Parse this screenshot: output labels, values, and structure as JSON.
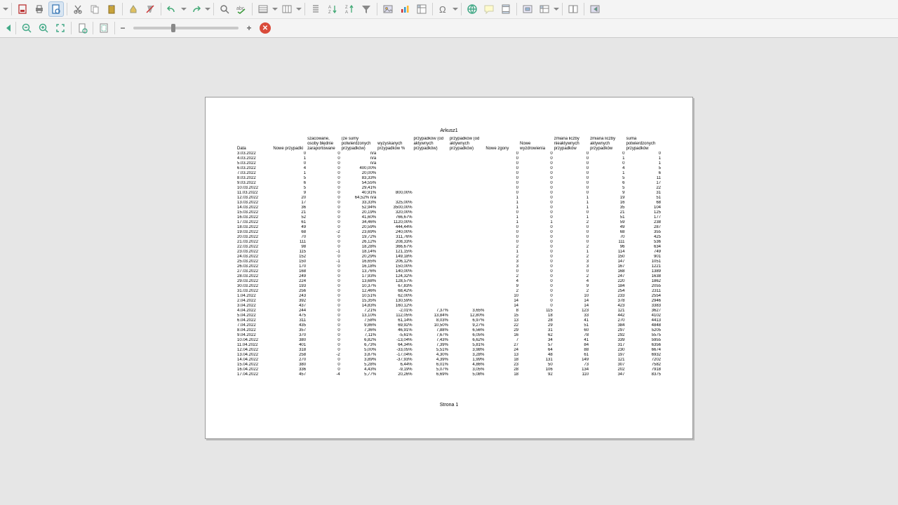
{
  "sheet": {
    "title": "Arkusz1",
    "footer": "Strona 1"
  },
  "zoom": {
    "minus": "−",
    "plus": "+",
    "thumb_pct": 36
  },
  "headers": [
    "Data",
    "Nowe przypadki",
    "szacowane, osoby błędnie zaraportowane",
    "(ze sumy potwierdzonych przypadków)",
    "wyzyskanych przypadków %",
    "przypadków (od aktywnych przypadków)",
    "przypadków (od aktywnych przypadków)",
    "Nowe zgony",
    "Nowe wyzdrowienia",
    "zmiana liczby nieaktywnych przypadków",
    "zmiana liczby aktywnych przypadków",
    "suma potwierdzonych przypadków"
  ],
  "rows": [
    [
      "3.03.2022",
      "0",
      "0",
      "n/a",
      "",
      "",
      "",
      "0",
      "0",
      "0",
      "0",
      "0"
    ],
    [
      "4.03.2022",
      "1",
      "0",
      "n/a",
      "",
      "",
      "",
      "0",
      "0",
      "0",
      "1",
      "1"
    ],
    [
      "5.03.2022",
      "0",
      "0",
      "n/a",
      "",
      "",
      "",
      "0",
      "0",
      "0",
      "0",
      "1"
    ],
    [
      "6.03.2022",
      "4",
      "0",
      "400,00%",
      "",
      "",
      "",
      "0",
      "0",
      "0",
      "4",
      "5"
    ],
    [
      "7.03.2022",
      "1",
      "0",
      "20,00%",
      "",
      "",
      "",
      "0",
      "0",
      "0",
      "1",
      "6"
    ],
    [
      "8.03.2022",
      "5",
      "0",
      "83,33%",
      "",
      "",
      "",
      "0",
      "0",
      "0",
      "5",
      "11"
    ],
    [
      "9.03.2022",
      "6",
      "0",
      "54,55%",
      "",
      "",
      "",
      "0",
      "0",
      "0",
      "6",
      "17"
    ],
    [
      "10.03.2022",
      "5",
      "0",
      "29,41%",
      "",
      "",
      "",
      "0",
      "0",
      "0",
      "5",
      "22"
    ],
    [
      "11.03.2022",
      "9",
      "0",
      "40,91%",
      "800,00%",
      "",
      "",
      "0",
      "0",
      "0",
      "9",
      "31"
    ],
    [
      "12.03.2022",
      "20",
      "0",
      "64,52% n/a",
      "",
      "",
      "",
      "1",
      "0",
      "1",
      "19",
      "51"
    ],
    [
      "13.03.2022",
      "17",
      "0",
      "33,33%",
      "325,00%",
      "",
      "",
      "1",
      "0",
      "1",
      "16",
      "68"
    ],
    [
      "14.03.2022",
      "36",
      "0",
      "52,94%",
      "3500,00%",
      "",
      "",
      "1",
      "0",
      "1",
      "35",
      "104"
    ],
    [
      "15.03.2022",
      "21",
      "0",
      "20,19%",
      "320,00%",
      "",
      "",
      "0",
      "0",
      "0",
      "21",
      "125"
    ],
    [
      "16.03.2022",
      "52",
      "0",
      "41,60%",
      "766,67%",
      "",
      "",
      "1",
      "0",
      "1",
      "51",
      "177"
    ],
    [
      "17.03.2022",
      "61",
      "0",
      "34,46%",
      "1120,00%",
      "",
      "",
      "1",
      "1",
      "2",
      "59",
      "238"
    ],
    [
      "18.03.2022",
      "49",
      "0",
      "20,59%",
      "444,44%",
      "",
      "",
      "0",
      "0",
      "0",
      "49",
      "287"
    ],
    [
      "19.03.2022",
      "68",
      "-2",
      "23,69%",
      "240,00%",
      "",
      "",
      "0",
      "0",
      "0",
      "68",
      "355"
    ],
    [
      "20.03.2022",
      "70",
      "0",
      "19,72%",
      "311,76%",
      "",
      "",
      "0",
      "0",
      "0",
      "70",
      "425"
    ],
    [
      "21.03.2022",
      "111",
      "0",
      "26,12%",
      "208,33%",
      "",
      "",
      "0",
      "0",
      "0",
      "111",
      "536"
    ],
    [
      "22.03.2022",
      "98",
      "0",
      "18,28%",
      "366,67%",
      "",
      "",
      "2",
      "0",
      "2",
      "96",
      "634"
    ],
    [
      "23.03.2022",
      "115",
      "-1",
      "18,14%",
      "121,15%",
      "",
      "",
      "1",
      "0",
      "1",
      "114",
      "749"
    ],
    [
      "24.03.2022",
      "152",
      "0",
      "20,29%",
      "149,18%",
      "",
      "",
      "2",
      "0",
      "2",
      "150",
      "901"
    ],
    [
      "25.03.2022",
      "150",
      "-1",
      "16,65%",
      "206,12%",
      "",
      "",
      "3",
      "0",
      "3",
      "147",
      "1051"
    ],
    [
      "26.03.2022",
      "170",
      "0",
      "16,18%",
      "150,00%",
      "",
      "",
      "3",
      "0",
      "3",
      "167",
      "1221"
    ],
    [
      "27.03.2022",
      "168",
      "0",
      "13,76%",
      "140,00%",
      "",
      "",
      "0",
      "0",
      "0",
      "168",
      "1389"
    ],
    [
      "28.03.2022",
      "249",
      "0",
      "17,93%",
      "124,32%",
      "",
      "",
      "2",
      "0",
      "2",
      "247",
      "1638"
    ],
    [
      "29.03.2022",
      "224",
      "0",
      "13,68%",
      "128,57%",
      "",
      "",
      "4",
      "0",
      "4",
      "220",
      "1862"
    ],
    [
      "30.03.2022",
      "193",
      "0",
      "10,37%",
      "67,83%",
      "",
      "",
      "9",
      "0",
      "9",
      "184",
      "2055"
    ],
    [
      "31.03.2022",
      "256",
      "0",
      "12,46%",
      "68,42%",
      "",
      "",
      "2",
      "0",
      "2",
      "254",
      "2311"
    ],
    [
      "1.04.2022",
      "243",
      "0",
      "10,51%",
      "62,00%",
      "",
      "",
      "10",
      "0",
      "10",
      "233",
      "2554"
    ],
    [
      "2.04.2022",
      "392",
      "0",
      "15,35%",
      "130,59%",
      "",
      "",
      "14",
      "0",
      "14",
      "378",
      "2946"
    ],
    [
      "3.04.2022",
      "437",
      "0",
      "14,83%",
      "160,12%",
      "",
      "",
      "14",
      "0",
      "14",
      "423",
      "3383"
    ],
    [
      "4.04.2022",
      "244",
      "0",
      "7,21%",
      "-2,01%",
      "7,37%",
      "3,65%",
      "8",
      "115",
      "123",
      "121",
      "3627"
    ],
    [
      "5.04.2022",
      "475",
      "0",
      "13,10%",
      "112,05%",
      "13,84%",
      "12,80%",
      "15",
      "18",
      "33",
      "442",
      "4102"
    ],
    [
      "6.04.2022",
      "311",
      "0",
      "7,58%",
      "61,14%",
      "8,03%",
      "6,97%",
      "13",
      "28",
      "41",
      "270",
      "4413"
    ],
    [
      "7.04.2022",
      "435",
      "0",
      "9,86%",
      "69,92%",
      "10,50%",
      "9,27%",
      "22",
      "29",
      "51",
      "384",
      "4848"
    ],
    [
      "8.04.2022",
      "357",
      "0",
      "7,36%",
      "46,91%",
      "7,88%",
      "6,56%",
      "29",
      "31",
      "60",
      "297",
      "5205"
    ],
    [
      "9.04.2022",
      "370",
      "0",
      "7,11%",
      "-5,61%",
      "7,67%",
      "6,05%",
      "16",
      "62",
      "78",
      "292",
      "5575"
    ],
    [
      "10.04.2022",
      "380",
      "0",
      "6,82%",
      "-13,04%",
      "7,43%",
      "6,62%",
      "7",
      "34",
      "41",
      "339",
      "5955"
    ],
    [
      "11.04.2022",
      "401",
      "0",
      "6,73%",
      "64,34%",
      "7,39%",
      "5,81%",
      "27",
      "57",
      "84",
      "317",
      "6356"
    ],
    [
      "12.04.2022",
      "318",
      "0",
      "5,00%",
      "-33,05%",
      "5,51%",
      "3,98%",
      "24",
      "64",
      "88",
      "230",
      "6674"
    ],
    [
      "13.04.2022",
      "258",
      "-2",
      "3,87%",
      "-17,04%",
      "4,30%",
      "3,28%",
      "13",
      "48",
      "61",
      "197",
      "6932"
    ],
    [
      "14.04.2022",
      "270",
      "0",
      "3,89%",
      "-37,93%",
      "4,39%",
      "1,99%",
      "18",
      "131",
      "149",
      "121",
      "7202"
    ],
    [
      "15.04.2022",
      "380",
      "0",
      "5,28%",
      "6,44%",
      "6,01%",
      "4,86%",
      "23",
      "50",
      "73",
      "307",
      "7582"
    ],
    [
      "16.04.2022",
      "336",
      "0",
      "4,43%",
      "-9,19%",
      "5,07%",
      "3,05%",
      "28",
      "106",
      "134",
      "202",
      "7918"
    ],
    [
      "17.04.2022",
      "457",
      "-4",
      "5,77%",
      "20,26%",
      "6,69%",
      "5,08%",
      "18",
      "92",
      "110",
      "347",
      "8375"
    ]
  ]
}
